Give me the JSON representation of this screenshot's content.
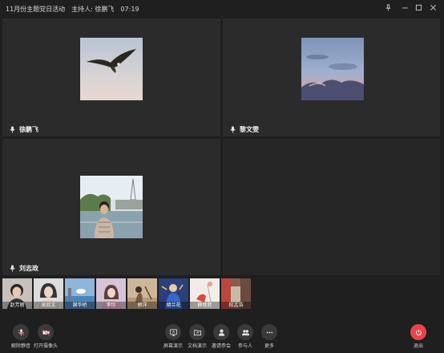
{
  "meeting": {
    "title": "11月份主题党日活动",
    "host": "主持人: 徐鹏飞",
    "time": "07:19"
  },
  "tiles": [
    {
      "name": "徐鹏飞",
      "image": "eagle"
    },
    {
      "name": "黎文雯",
      "image": "sky"
    },
    {
      "name": "刘志政",
      "image": "paris"
    }
  ],
  "participants": [
    {
      "name": "赵芳丽"
    },
    {
      "name": "吴欣文"
    },
    {
      "name": "谢华桥"
    },
    {
      "name": "李玲"
    },
    {
      "name": "郭洋"
    },
    {
      "name": "胡兰花"
    },
    {
      "name": "薛菲菲"
    },
    {
      "name": "段孟浩"
    }
  ],
  "toolbar": {
    "unmute": "解除静音",
    "camera": "打开摄像头",
    "screen_share": "屏幕演示",
    "doc_share": "文档演示",
    "invite": "邀请参会",
    "attendees": "参与人",
    "more": "更多",
    "exit": "退出"
  },
  "colors": {
    "background": "#1f1f1f",
    "tile": "#2b2b2b",
    "exit_button": "#e7454a"
  }
}
